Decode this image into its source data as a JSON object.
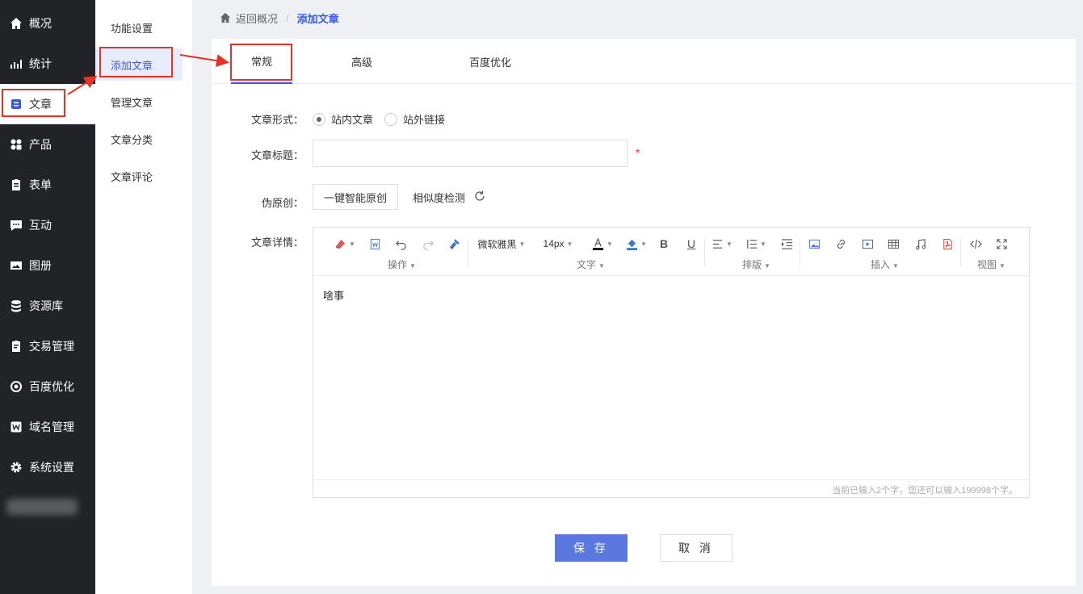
{
  "sidebar": {
    "items": [
      {
        "label": "概况",
        "icon": "home-icon"
      },
      {
        "label": "统计",
        "icon": "chart-icon"
      },
      {
        "label": "文章",
        "icon": "article-icon"
      },
      {
        "label": "产品",
        "icon": "grid-icon"
      },
      {
        "label": "表单",
        "icon": "clipboard-icon"
      },
      {
        "label": "互动",
        "icon": "chat-icon"
      },
      {
        "label": "图册",
        "icon": "image-icon"
      },
      {
        "label": "资源库",
        "icon": "database-icon"
      },
      {
        "label": "交易管理",
        "icon": "order-icon"
      },
      {
        "label": "百度优化",
        "icon": "target-icon"
      },
      {
        "label": "域名管理",
        "icon": "domain-icon"
      },
      {
        "label": "系统设置",
        "icon": "gear-icon"
      }
    ],
    "active": "文章"
  },
  "subnav": {
    "items": [
      "功能设置",
      "添加文章",
      "管理文章",
      "文章分类",
      "文章评论"
    ],
    "active": "添加文章"
  },
  "breadcrumb": {
    "back": "返回概况",
    "separator": "/",
    "current": "添加文章"
  },
  "tabs": [
    {
      "label": "常规"
    },
    {
      "label": "高级"
    },
    {
      "label": "百度优化"
    }
  ],
  "form": {
    "type_label": "文章形式：",
    "type_options": [
      "站内文章",
      "站外链接"
    ],
    "type_selected": "站内文章",
    "title_label": "文章标题：",
    "title_value": "",
    "required_mark": "*",
    "pseudo_label": "伪原创：",
    "pseudo_button": "一键智能原创",
    "similarity_link": "相似度检测",
    "detail_label": "文章详情："
  },
  "editor": {
    "font_family": "微软雅黑",
    "font_size": "14px",
    "groups": [
      "操作",
      "文字",
      "排版",
      "插入",
      "视图"
    ],
    "content": "啥事",
    "status": "当前已输入2个字，您还可以输入199998个字。"
  },
  "actions": {
    "save": "保 存",
    "cancel": "取 消"
  },
  "colors": {
    "accent": "#3b5bdb",
    "annotation": "#e5332a",
    "sidebar_bg": "#222326",
    "save_bg": "#5b78e0"
  }
}
